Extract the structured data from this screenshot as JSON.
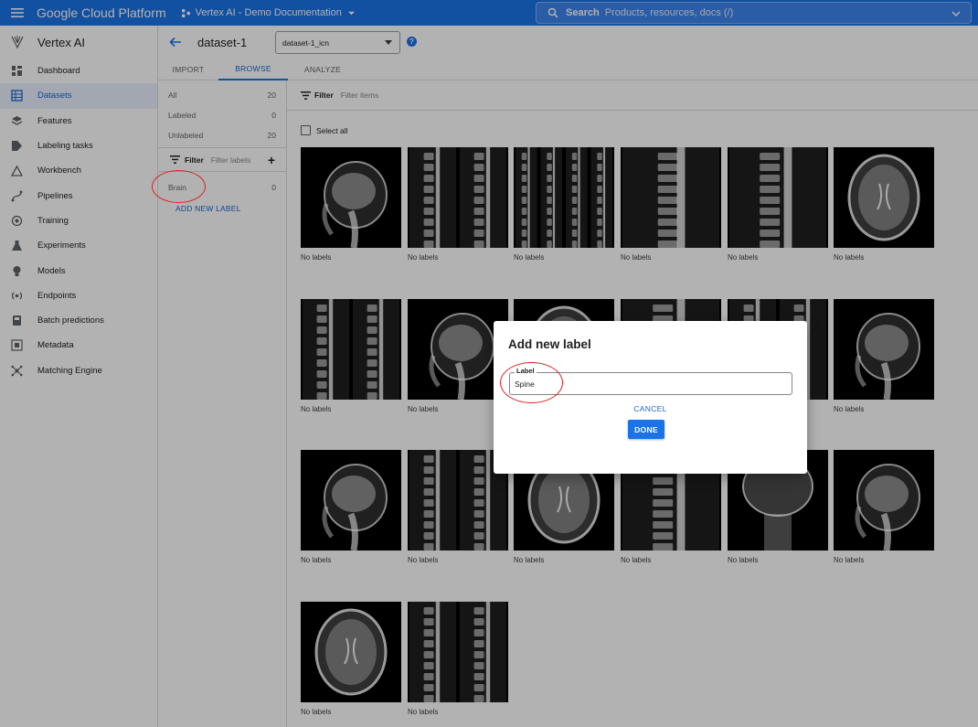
{
  "topbar": {
    "product": "Google Cloud Platform",
    "project": "Vertex AI - Demo Documentation",
    "search_label": "Search",
    "search_placeholder": "Products, resources, docs (/)"
  },
  "leftnav": {
    "title": "Vertex AI",
    "items": [
      {
        "label": "Dashboard",
        "icon": "dashboard-icon"
      },
      {
        "label": "Datasets",
        "icon": "datasets-icon"
      },
      {
        "label": "Features",
        "icon": "features-icon"
      },
      {
        "label": "Labeling tasks",
        "icon": "labeling-tasks-icon"
      },
      {
        "label": "Workbench",
        "icon": "workbench-icon"
      },
      {
        "label": "Pipelines",
        "icon": "pipelines-icon"
      },
      {
        "label": "Training",
        "icon": "training-icon"
      },
      {
        "label": "Experiments",
        "icon": "experiments-icon"
      },
      {
        "label": "Models",
        "icon": "models-icon"
      },
      {
        "label": "Endpoints",
        "icon": "endpoints-icon"
      },
      {
        "label": "Batch predictions",
        "icon": "batch-predictions-icon"
      },
      {
        "label": "Metadata",
        "icon": "metadata-icon"
      },
      {
        "label": "Matching Engine",
        "icon": "matching-engine-icon"
      }
    ],
    "active": "Datasets"
  },
  "header": {
    "dataset_title": "dataset-1",
    "dataset_select": "dataset-1_icn",
    "help": "?"
  },
  "tabs": [
    "IMPORT",
    "BROWSE",
    "ANALYZE"
  ],
  "active_tab": "BROWSE",
  "label_panel": {
    "counts": [
      {
        "label": "All",
        "count": "20"
      },
      {
        "label": "Labeled",
        "count": "0"
      },
      {
        "label": "Unlabeled",
        "count": "20"
      }
    ],
    "filter_label": "Filter",
    "filter_placeholder": "Filter labels",
    "labels": [
      {
        "label": "Brain",
        "count": "0"
      }
    ],
    "add_new_label": "ADD NEW LABEL"
  },
  "grid": {
    "filter_label": "Filter",
    "filter_placeholder": "Filter items",
    "select_all": "Select all",
    "item_caption": "No labels",
    "item_count": 20
  },
  "dialog": {
    "title": "Add new label",
    "field_label": "Label",
    "field_value": "Spine",
    "cancel": "CANCEL",
    "done": "DONE"
  },
  "colors": {
    "brand_blue": "#1a73e8",
    "annotation_red": "#e02020"
  }
}
